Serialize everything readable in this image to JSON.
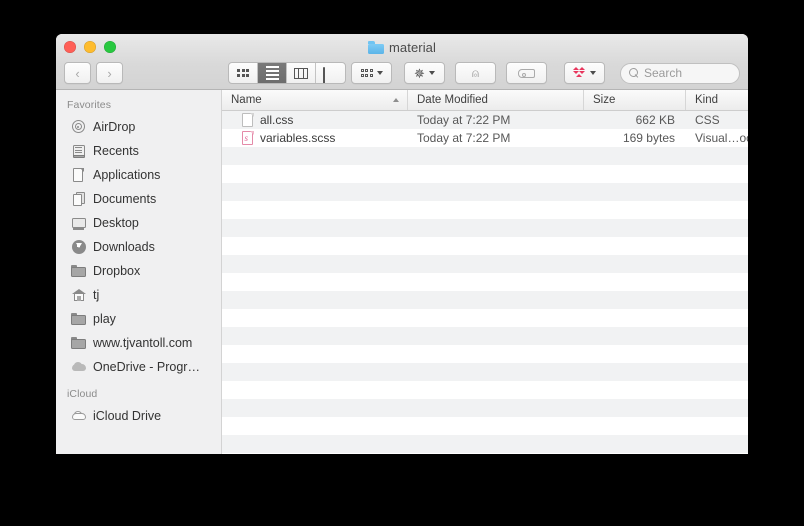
{
  "window": {
    "title": "material",
    "title_icon": "folder-icon",
    "traffic_lights": [
      {
        "name": "close-button",
        "color": "#ff5f57"
      },
      {
        "name": "minimize-button",
        "color": "#febc2e"
      },
      {
        "name": "maximize-button",
        "color": "#28c840"
      }
    ]
  },
  "toolbar": {
    "back_label": "‹",
    "forward_label": "›",
    "view_modes": [
      {
        "name": "icon-view",
        "icon": "grid-icon",
        "active": false
      },
      {
        "name": "list-view",
        "icon": "list-icon",
        "active": true
      },
      {
        "name": "column-view",
        "icon": "columns-icon",
        "active": false
      },
      {
        "name": "gallery-view",
        "icon": "gallery-icon",
        "active": false
      }
    ],
    "arrange_icon": "arrange-icon",
    "action_icon": "gear-icon",
    "share_icon": "share-icon",
    "tag_icon": "tag-icon",
    "dropbox_icon": "dropbox-icon"
  },
  "search": {
    "placeholder": "Search",
    "value": "",
    "icon": "search-icon"
  },
  "sidebar": {
    "sections": [
      {
        "header": "Favorites",
        "items": [
          {
            "label": "AirDrop",
            "icon": "airdrop-icon"
          },
          {
            "label": "Recents",
            "icon": "recents-icon"
          },
          {
            "label": "Applications",
            "icon": "applications-icon"
          },
          {
            "label": "Documents",
            "icon": "documents-icon"
          },
          {
            "label": "Desktop",
            "icon": "desktop-icon"
          },
          {
            "label": "Downloads",
            "icon": "downloads-icon"
          },
          {
            "label": "Dropbox",
            "icon": "folder-icon"
          },
          {
            "label": "tj",
            "icon": "home-icon"
          },
          {
            "label": "play",
            "icon": "folder-icon"
          },
          {
            "label": "www.tjvantoll.com",
            "icon": "folder-icon"
          },
          {
            "label": "OneDrive - Progr…",
            "icon": "cloud-icon"
          }
        ]
      },
      {
        "header": "iCloud",
        "items": [
          {
            "label": "iCloud Drive",
            "icon": "cloud-outline-icon"
          }
        ]
      }
    ]
  },
  "filelist": {
    "columns": [
      {
        "label": "Name",
        "sorted": "asc"
      },
      {
        "label": "Date Modified",
        "sorted": ""
      },
      {
        "label": "Size",
        "sorted": ""
      },
      {
        "label": "Kind",
        "sorted": ""
      }
    ],
    "rows": [
      {
        "name": "all.css",
        "date_modified": "Today at 7:22 PM",
        "size": "662 KB",
        "kind": "CSS",
        "icon": "document-icon"
      },
      {
        "name": "variables.scss",
        "date_modified": "Today at 7:22 PM",
        "size": "169 bytes",
        "kind": "Visual…oc",
        "icon": "sass-document-icon"
      }
    ],
    "empty_row_count": 18
  },
  "colors": {
    "stripe": "#f1f2f3",
    "sidebar_bg": "#f0f0f1",
    "accent_selected": "#6d6d6d",
    "sass_pink": "#df5a8e",
    "folder_blue": "#5bb4e8",
    "dropbox_red": "#e8365d"
  }
}
